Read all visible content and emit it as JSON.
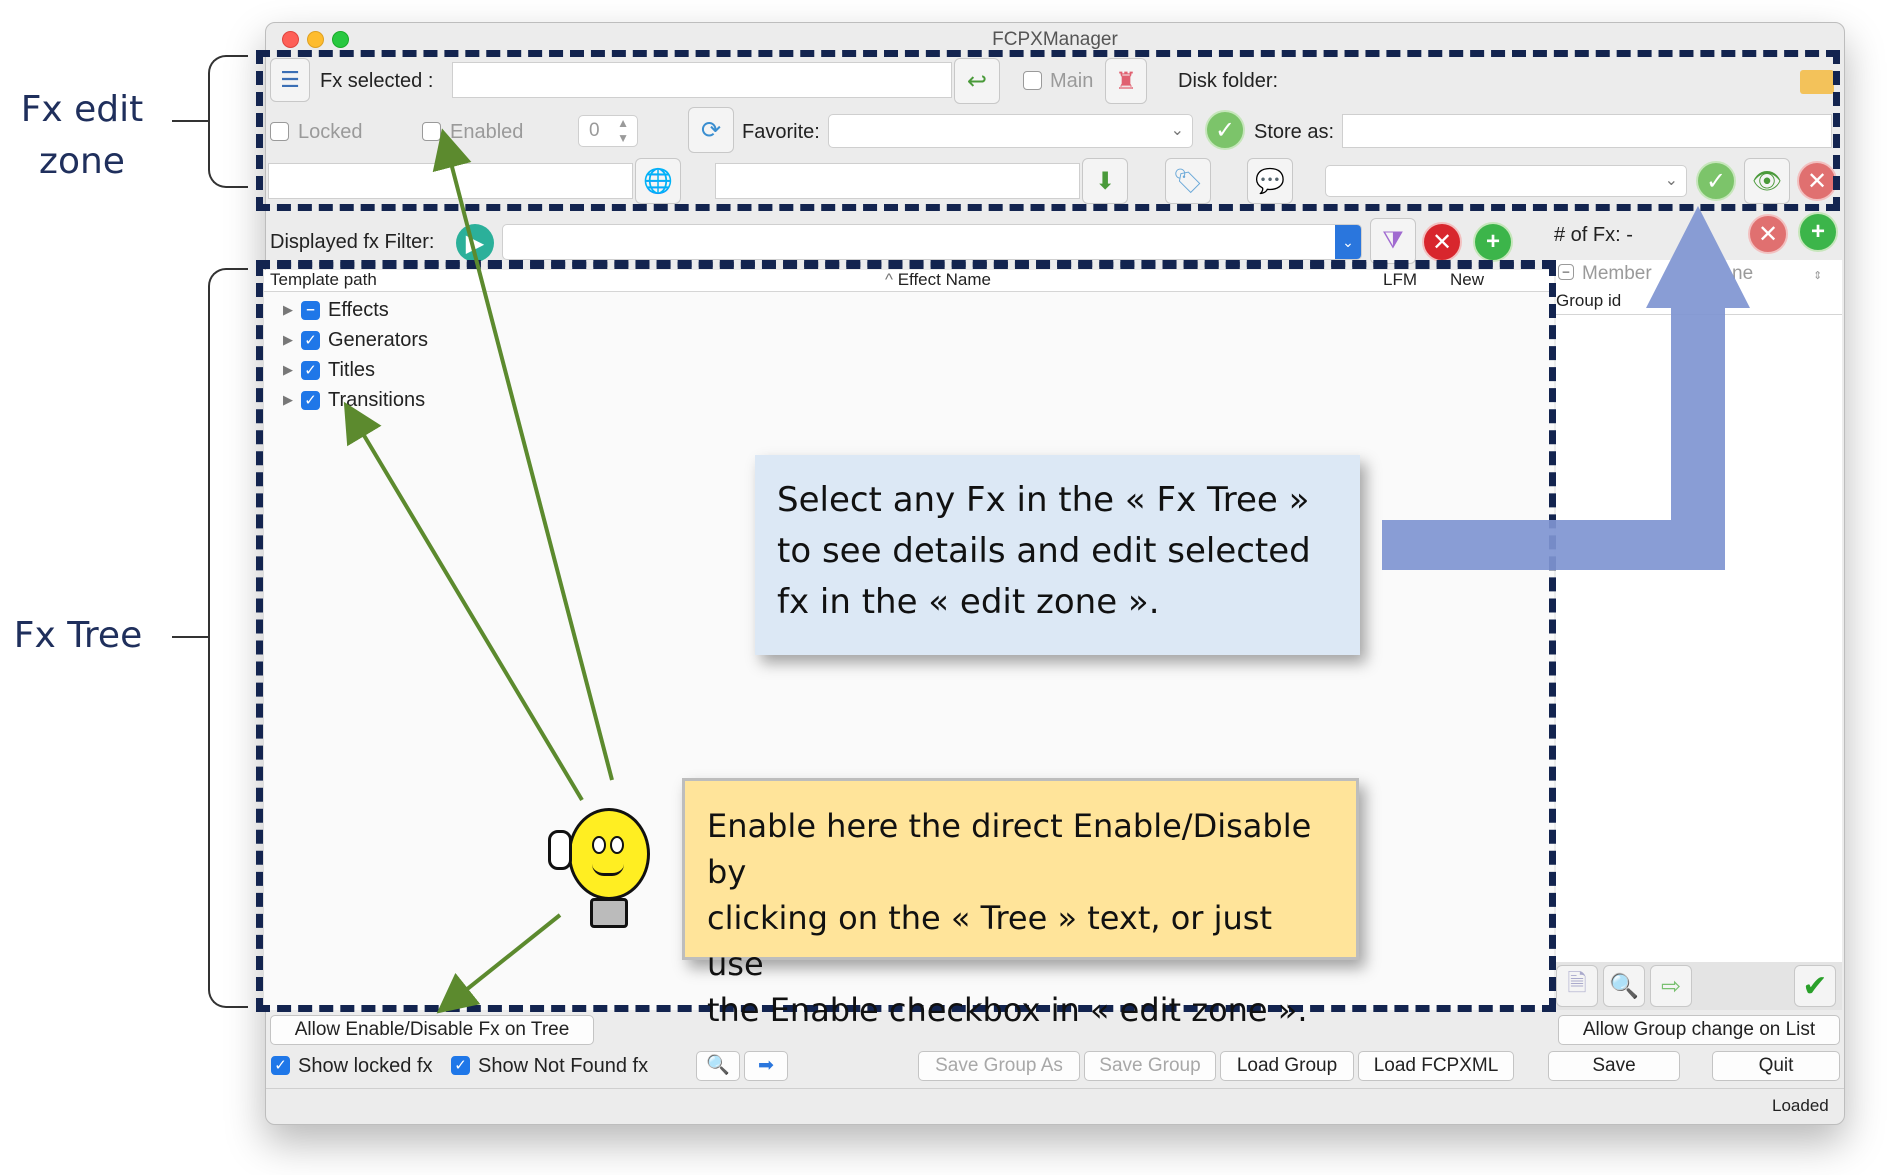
{
  "annotations": {
    "edit_zone": [
      "Fx edit",
      "zone"
    ],
    "tree": "Fx Tree"
  },
  "window": {
    "title": "FCPXManager"
  },
  "edit_zone": {
    "fx_selected_label": "Fx selected :",
    "main_label": "Main",
    "disk_folder_label": "Disk folder:",
    "locked_label": "Locked",
    "enabled_label": "Enabled",
    "stepper_value": "0",
    "favorite_label": "Favorite:",
    "store_as_label": "Store as:"
  },
  "filter": {
    "label": "Displayed fx Filter:",
    "count_label": "# of Fx: -"
  },
  "tree": {
    "columns": {
      "template_path": "Template path",
      "effect_name": "Effect Name",
      "lfm": "LFM",
      "new": "New"
    },
    "items": [
      {
        "label": "Effects",
        "state": "mixed"
      },
      {
        "label": "Generators",
        "state": "checked"
      },
      {
        "label": "Titles",
        "state": "checked"
      },
      {
        "label": "Transitions",
        "state": "checked"
      }
    ]
  },
  "group": {
    "member_label": "Member",
    "type_label": "ne",
    "group_id_header": "Group id"
  },
  "callouts": {
    "blue": [
      "Select any Fx in the « Fx Tree »",
      "to see details and edit selected",
      "fx in the « edit zone »."
    ],
    "yellow": [
      "Enable here the direct Enable/Disable by",
      "clicking on the « Tree » text, or just use",
      "the Enable checkbox in « edit zone »."
    ]
  },
  "bottom": {
    "allow_tree": "Allow Enable/Disable Fx on Tree",
    "allow_group": "Allow Group change on List",
    "show_locked": "Show locked fx",
    "show_not_found": "Show Not Found fx",
    "save_group_as": "Save Group As",
    "save_group": "Save Group",
    "load_group": "Load Group",
    "load_fcpxml": "Load FCPXML",
    "save": "Save",
    "quit": "Quit",
    "status": "Loaded"
  },
  "colors": {
    "dash": "#13244f",
    "arrow_green": "#5c8a2e",
    "big_arrow": "#7f95d1",
    "blue_callout": "#dce8f5",
    "yellow_callout": "#ffe49a"
  }
}
